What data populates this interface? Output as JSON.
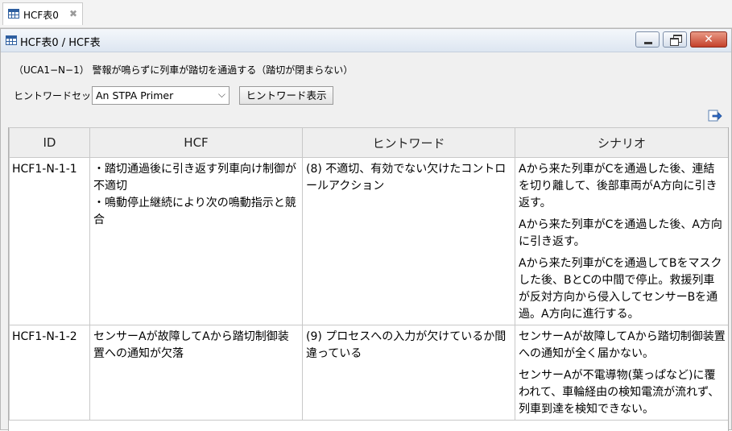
{
  "tab": {
    "label": "HCF表0"
  },
  "window": {
    "title": "HCF表0 / HCF表"
  },
  "description": "（UCA1−N−1） 警報が鳴らずに列車が踏切を通過する（踏切が閉まらない）",
  "hintset": {
    "label": "ヒントワードセット",
    "selected": "An STPA Primer",
    "button_label": "ヒントワード表示"
  },
  "table": {
    "headers": [
      "ID",
      "HCF",
      "ヒントワード",
      "シナリオ"
    ],
    "rows": [
      {
        "id": "HCF1-N-1-1",
        "hcf": [
          "・踏切通過後に引き返す列車向け制御が不適切",
          "・鳴動停止継続により次の鳴動指示と競合"
        ],
        "hint": "(8) 不適切、有効でない欠けたコントロールアクション",
        "scenarios": [
          "Aから来た列車がCを通過した後、連結を切り離して、後部車両がA方向に引き返す。",
          "Aから来た列車がCを通過した後、A方向に引き返す。",
          "Aから来た列車がCを通過してBをマスクした後、BとCの中間で停止。救援列車が反対方向から侵入してセンサーBを通過。A方向に進行する。"
        ]
      },
      {
        "id": "HCF1-N-1-2",
        "hcf": [
          "センサーAが故障してAから踏切制御装置への通知が欠落"
        ],
        "hint": "(9) プロセスへの入力が欠けているか間違っている",
        "scenarios": [
          "センサーAが故障してAから踏切制御装置への通知が全く届かない。",
          "センサーAが不電導物(葉っぱなど)に覆われて、車輪経由の検知電流が流れず、列車到達を検知できない。"
        ]
      }
    ]
  }
}
